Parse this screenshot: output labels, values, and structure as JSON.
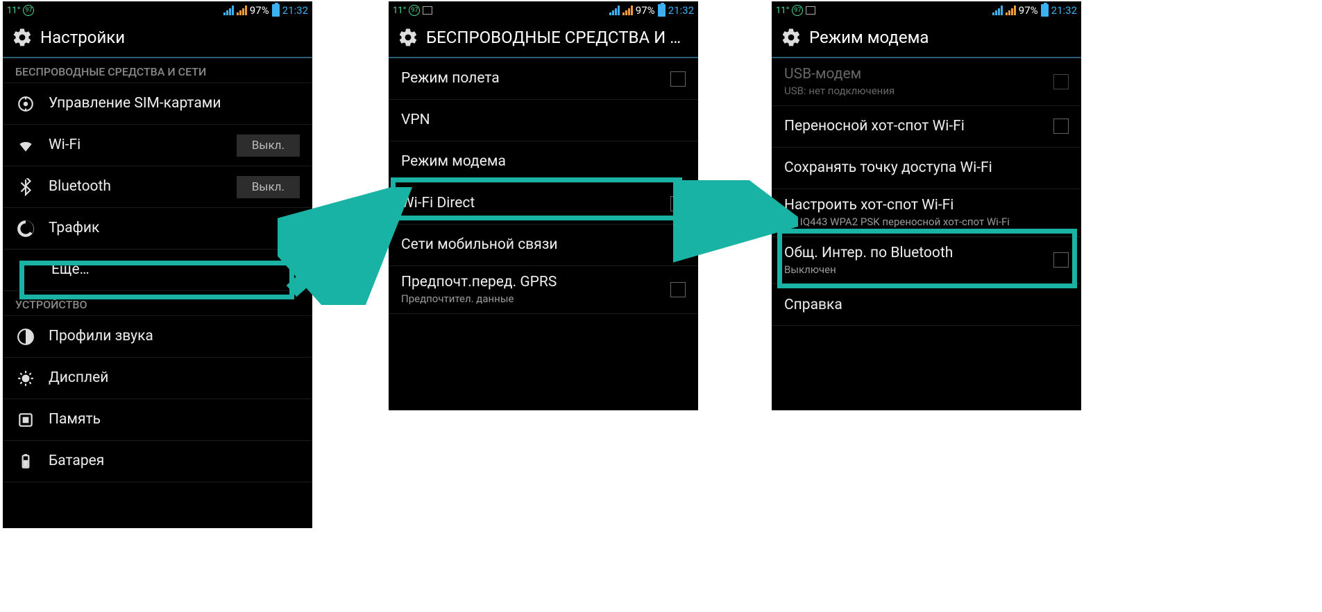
{
  "statusbar": {
    "temp": "11°",
    "qs": "97",
    "pct": "97%",
    "time": "21:32"
  },
  "screen1": {
    "title": "Настройки",
    "section1": "БЕСПРОВОДНЫЕ СРЕДСТВА И СЕТИ",
    "section2": "УСТРОЙСТВО",
    "items": {
      "sim": "Управление SIM-картами",
      "wifi": "Wi-Fi",
      "bt": "Bluetooth",
      "data": "Трафик",
      "more": "Еще…",
      "toggle_off": "Выкл.",
      "sound": "Профили звука",
      "display": "Дисплей",
      "storage": "Память",
      "battery": "Батарея"
    }
  },
  "screen2": {
    "title": "БЕСПРОВОДНЫЕ СРЕДСТВА И СЕ…",
    "items": {
      "airplane": "Режим полета",
      "vpn": "VPN",
      "tether": "Режим модема",
      "wifidir": "Wi-Fi Direct",
      "mobile": "Сети мобильной связи",
      "gprs": "Предпочт.перед. GPRS",
      "gprs_sub": "Предпочтител. данные"
    }
  },
  "screen3": {
    "title": "Режим модема",
    "items": {
      "usb": "USB-модем",
      "usb_sub": "USB: нет подключения",
      "hotspot": "Переносной хот-спот Wi-Fi",
      "keep": "Сохранять точку доступа Wi-Fi",
      "setup": "Настроить хот-спот Wi-Fi",
      "setup_sub": "Fly IQ443 WPA2 PSK переносной хот-спот Wi-Fi",
      "btshare": "Общ. Интер. по Bluetooth",
      "btshare_sub": "Выключен",
      "help": "Справка"
    }
  },
  "colors": {
    "accent": "#19b3a6"
  }
}
